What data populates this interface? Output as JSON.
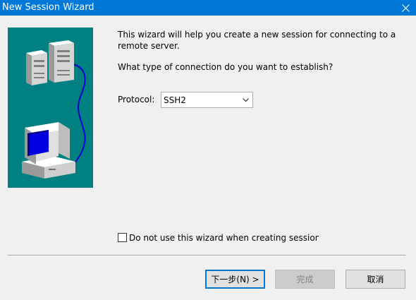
{
  "window": {
    "title": "New Session Wizard",
    "close_icon": "close-icon"
  },
  "illustration": {
    "background": "#008080",
    "icons": [
      "server-tower-icon",
      "workstation-computer-icon",
      "network-cable-icon"
    ]
  },
  "content": {
    "intro": "This wizard will help you create a new session for connecting to a remote server.",
    "question": "What type of connection do you want to establish?",
    "protocol_label": "Protocol:",
    "protocol_value": "SSH2",
    "checkbox_label": "Do not use this wizard when creating sessions",
    "checkbox_checked": false
  },
  "buttons": {
    "next": "下一步(N) >",
    "finish": "完成",
    "cancel": "取消"
  },
  "colors": {
    "titlebar": "#0078d7",
    "accent": "#0078d7"
  }
}
